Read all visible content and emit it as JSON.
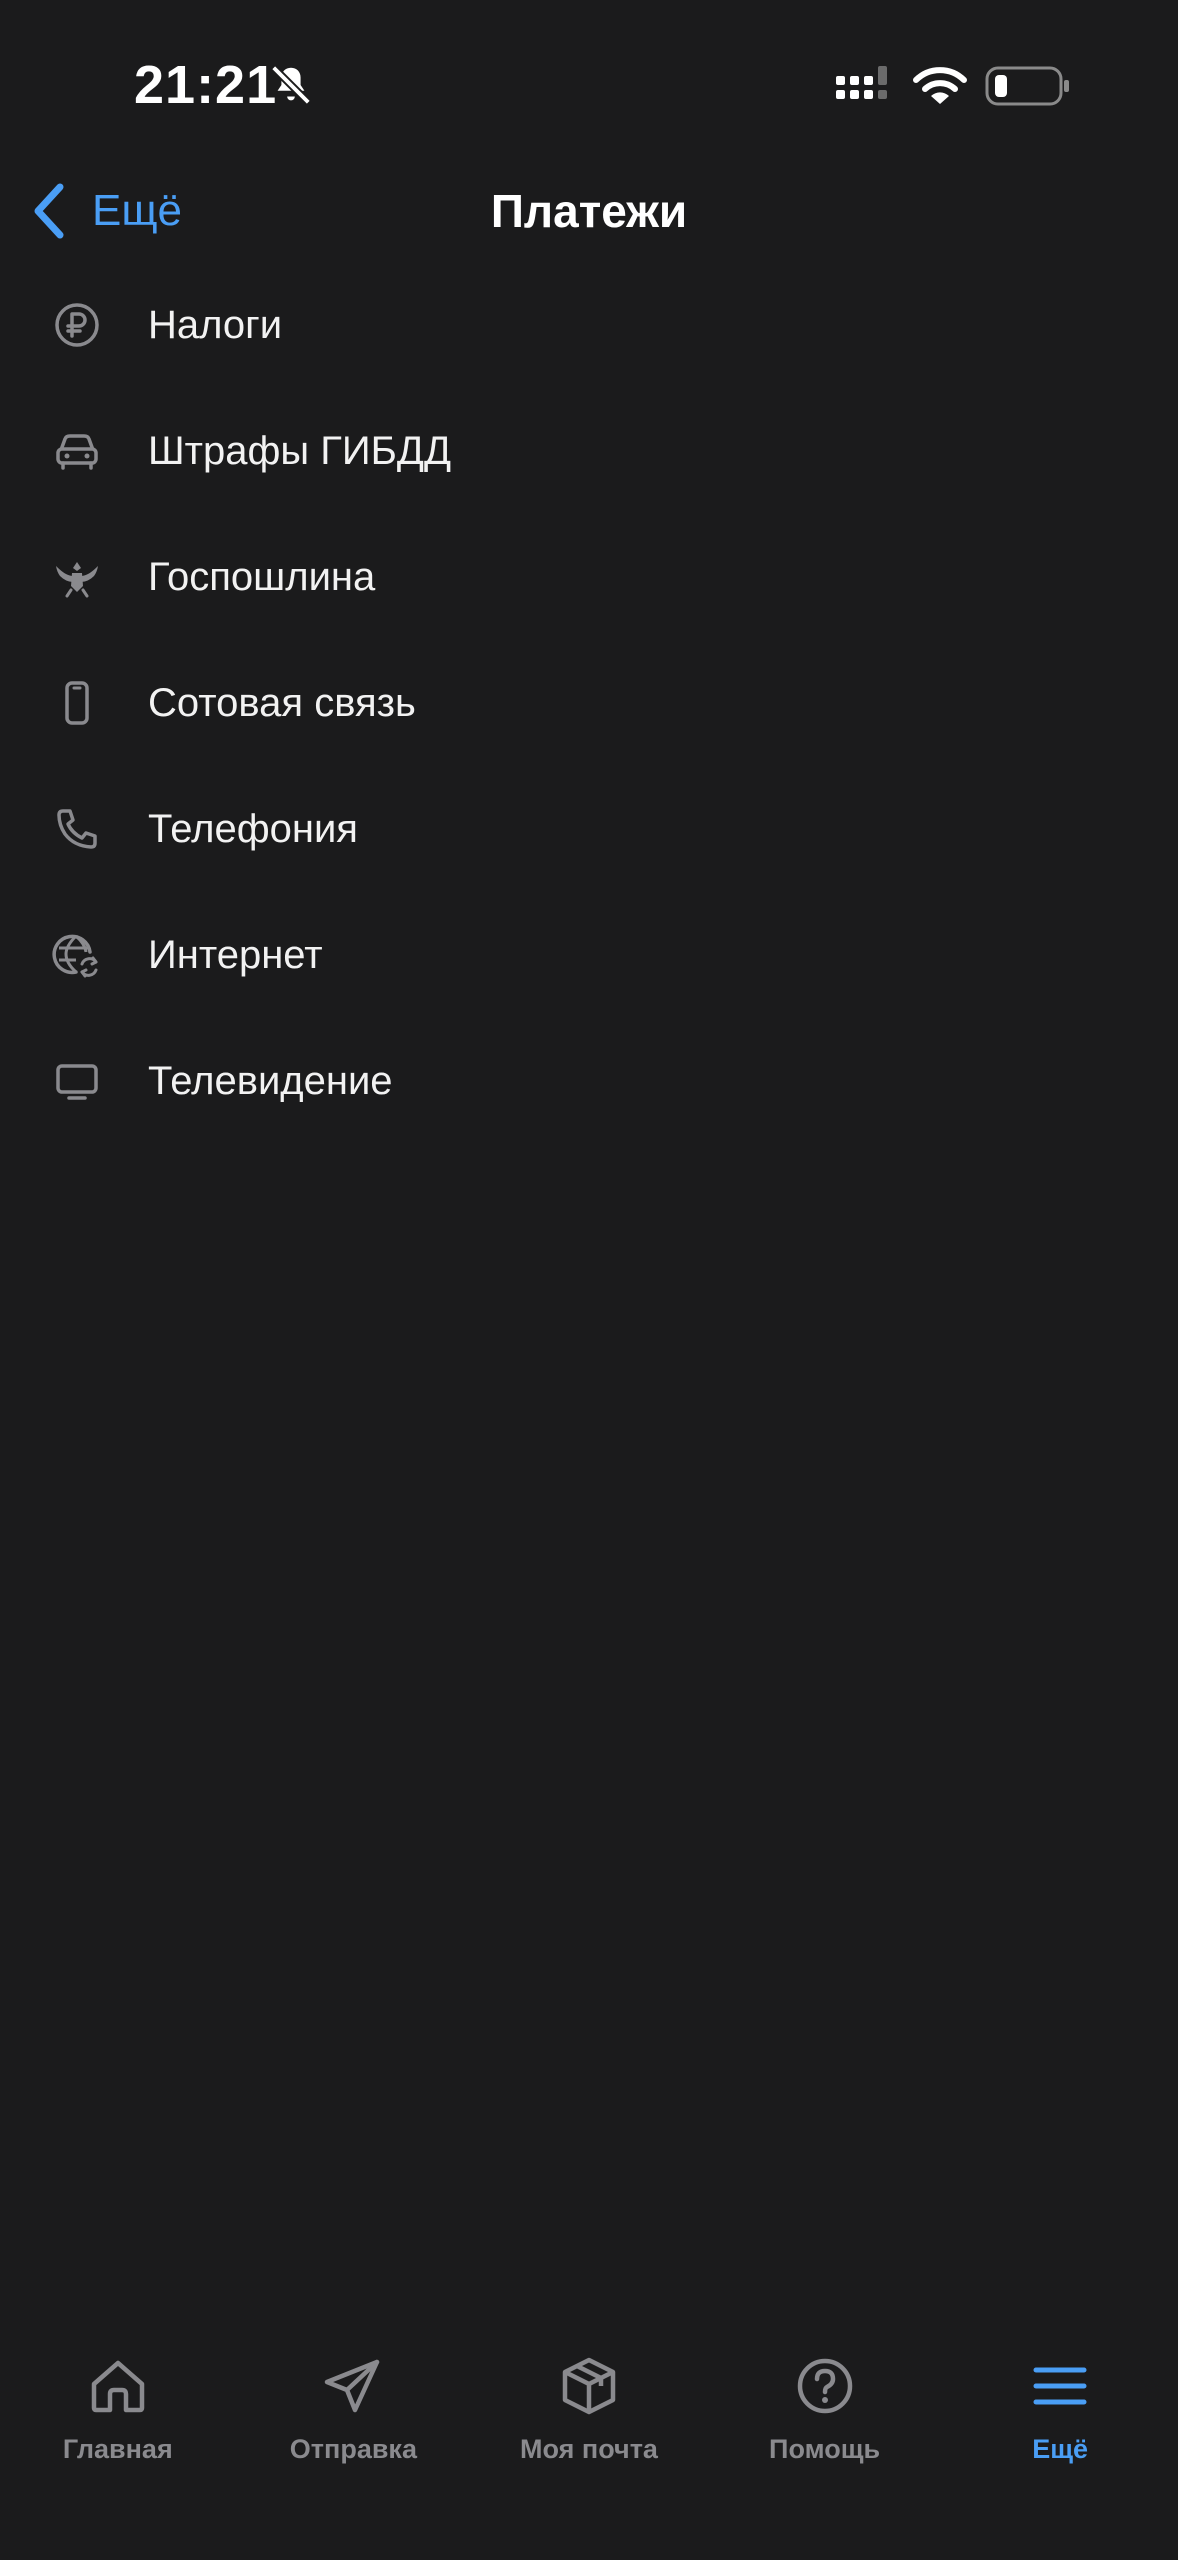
{
  "status_bar": {
    "time": "21:21",
    "icons": [
      "bell-slash-icon",
      "signal-icon",
      "wifi-icon",
      "battery-icon"
    ]
  },
  "nav": {
    "back_label": "Ещё",
    "title": "Платежи"
  },
  "items": [
    {
      "label": "Налоги",
      "icon": "ruble-icon"
    },
    {
      "label": "Штрафы ГИБДД",
      "icon": "car-icon"
    },
    {
      "label": "Госпошлина",
      "icon": "coat-of-arms-icon"
    },
    {
      "label": "Сотовая связь",
      "icon": "mobile-phone-icon"
    },
    {
      "label": "Телефония",
      "icon": "phone-handset-icon"
    },
    {
      "label": "Интернет",
      "icon": "globe-icon"
    },
    {
      "label": "Телевидение",
      "icon": "tv-icon"
    }
  ],
  "tabs": [
    {
      "label": "Главная",
      "icon": "home-icon",
      "active": false
    },
    {
      "label": "Отправка",
      "icon": "paper-plane-icon",
      "active": false
    },
    {
      "label": "Моя почта",
      "icon": "package-icon",
      "active": false
    },
    {
      "label": "Помощь",
      "icon": "question-icon",
      "active": false
    },
    {
      "label": "Ещё",
      "icon": "menu-icon",
      "active": true
    }
  ],
  "colors": {
    "background": "#1b1b1c",
    "accent": "#4a9ef5",
    "text": "#f2f2f2",
    "icon": "#8a8a8e",
    "tab_inactive": "#8a8a8e"
  }
}
